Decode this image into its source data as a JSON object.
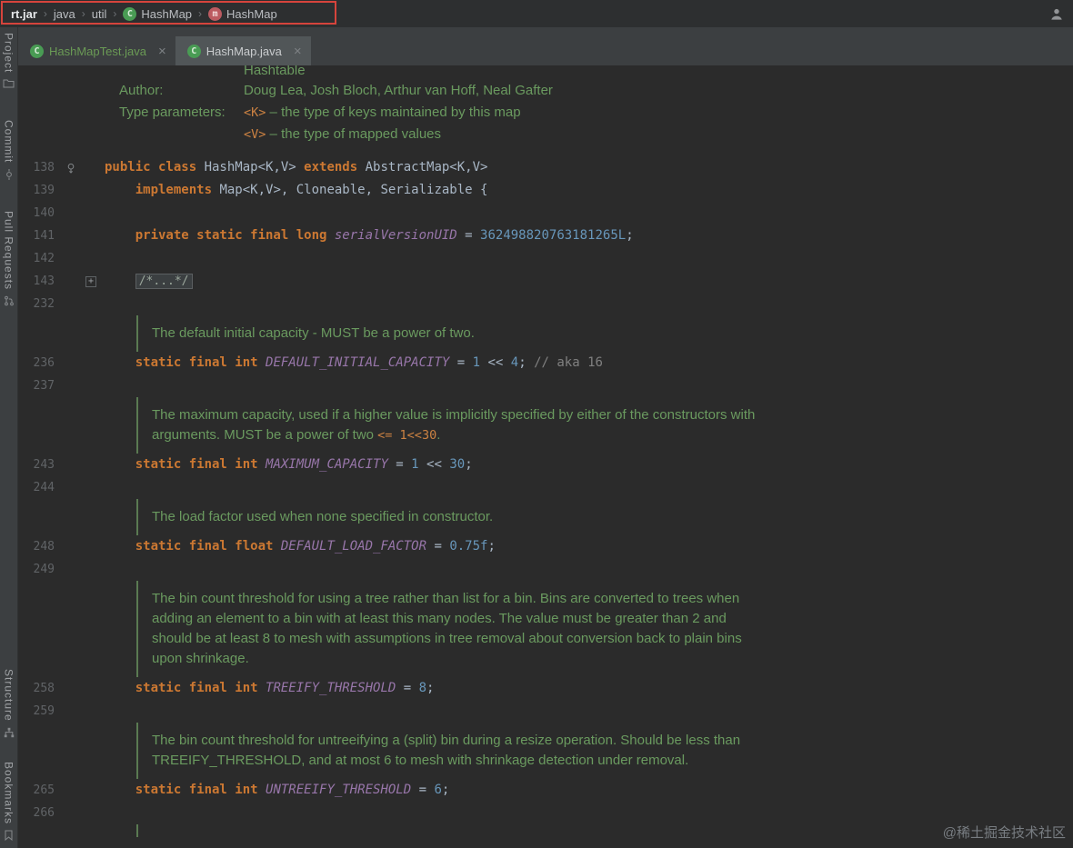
{
  "window": {
    "watermark": "@稀土掘金技术社区"
  },
  "colors": {
    "background": "#2B2B2B",
    "panel": "#3C3F41",
    "keyword": "#CC7832",
    "plain": "#A9B7C6",
    "constant": "#9876AA",
    "number": "#6897BB",
    "line_comment": "#808080",
    "doc_comment": "#6A9A5F",
    "doc_code": "#CC8242",
    "doc_bar": "#5A7A52",
    "line_number": "#606366",
    "vcs_added_green": "#6A9A55",
    "tab_active_bg": "#515658",
    "annotation_red": "#D6443C"
  },
  "breadcrumb_bar": {
    "separator": "›",
    "items": [
      {
        "label": "rt.jar",
        "bold": true
      },
      {
        "label": "java"
      },
      {
        "label": "util"
      },
      {
        "label": "HashMap",
        "icon": "class"
      },
      {
        "label": "HashMap",
        "icon": "method"
      }
    ]
  },
  "tab_bar": {
    "close_glyph": "×",
    "tabs": [
      {
        "label": "HashMapTest.java",
        "icon": "class",
        "active": false,
        "added": true
      },
      {
        "label": "HashMap.java",
        "icon": "class",
        "active": true,
        "added": false
      }
    ]
  },
  "tool_stripe": {
    "top": [
      {
        "label": "Project",
        "icon": "folder"
      },
      {
        "label": "Commit",
        "icon": "commit"
      },
      {
        "label": "Pull Requests",
        "icon": "pull-request"
      }
    ],
    "bottom": [
      {
        "label": "Structure",
        "icon": "structure"
      },
      {
        "label": "Bookmarks",
        "icon": "bookmark"
      }
    ]
  },
  "editor": {
    "blocks": [
      {
        "type": "doc-head",
        "partial": {
          "segs": [
            {
              "t": "Hashtable",
              "c": "doc"
            }
          ]
        },
        "rows": [
          {
            "label": "Author:",
            "segs": [
              {
                "t": "Doug Lea, Josh Bloch, Arthur van Hoff, Neal Gafter",
                "c": "doc"
              }
            ]
          },
          {
            "label": "Type parameters:",
            "segs": [
              {
                "t": "<K>",
                "c": "doccode"
              },
              {
                "t": " – the type of keys maintained by this map",
                "c": "doc"
              }
            ]
          },
          {
            "label": "",
            "segs": [
              {
                "t": "<V>",
                "c": "doccode"
              },
              {
                "t": " – the type of mapped values",
                "c": "doc"
              }
            ]
          }
        ]
      },
      {
        "type": "code",
        "ln": "138",
        "gutter_icon": "override",
        "segs": [
          {
            "t": "public class ",
            "c": "kw"
          },
          {
            "t": "HashMap<K,V> ",
            "c": "pl"
          },
          {
            "t": "extends ",
            "c": "kw"
          },
          {
            "t": "AbstractMap<K,V>",
            "c": "pl"
          }
        ]
      },
      {
        "type": "code",
        "ln": "139",
        "segs": [
          {
            "t": "    ",
            "c": "pl"
          },
          {
            "t": "implements ",
            "c": "kw"
          },
          {
            "t": "Map<K,V>, Cloneable, Serializable {",
            "c": "pl"
          }
        ]
      },
      {
        "type": "code",
        "ln": "140",
        "segs": []
      },
      {
        "type": "code",
        "ln": "141",
        "segs": [
          {
            "t": "    ",
            "c": "pl"
          },
          {
            "t": "private static final long ",
            "c": "kw"
          },
          {
            "t": "serialVersionUID",
            "c": "cf"
          },
          {
            "t": " = ",
            "c": "pl"
          },
          {
            "t": "362498820763181265L",
            "c": "num"
          },
          {
            "t": ";",
            "c": "pl"
          }
        ]
      },
      {
        "type": "code",
        "ln": "142",
        "segs": []
      },
      {
        "type": "code",
        "ln": "143",
        "gutter_icon": "fold",
        "segs": [
          {
            "t": "    ",
            "c": "pl"
          },
          {
            "t": "/*...*/",
            "c": "fold"
          }
        ]
      },
      {
        "type": "code",
        "ln": "232",
        "segs": []
      },
      {
        "type": "comment",
        "lines": [
          [
            {
              "t": "The default initial capacity - MUST be a power of two.",
              "c": "doc"
            }
          ]
        ]
      },
      {
        "type": "code",
        "ln": "236",
        "segs": [
          {
            "t": "    ",
            "c": "pl"
          },
          {
            "t": "static final int ",
            "c": "kw"
          },
          {
            "t": "DEFAULT_INITIAL_CAPACITY",
            "c": "cf"
          },
          {
            "t": " = ",
            "c": "pl"
          },
          {
            "t": "1",
            "c": "num"
          },
          {
            "t": " << ",
            "c": "pl"
          },
          {
            "t": "4",
            "c": "num"
          },
          {
            "t": "; ",
            "c": "pl"
          },
          {
            "t": "// aka 16",
            "c": "cm"
          }
        ]
      },
      {
        "type": "code",
        "ln": "237",
        "segs": []
      },
      {
        "type": "comment",
        "lines": [
          [
            {
              "t": "The maximum capacity, used if a higher value is implicitly specified by either of the constructors with",
              "c": "doc"
            }
          ],
          [
            {
              "t": "arguments. MUST be a power of two ",
              "c": "doc"
            },
            {
              "t": "<= 1<<30",
              "c": "doccode"
            },
            {
              "t": ".",
              "c": "doc"
            }
          ]
        ]
      },
      {
        "type": "code",
        "ln": "243",
        "segs": [
          {
            "t": "    ",
            "c": "pl"
          },
          {
            "t": "static final int ",
            "c": "kw"
          },
          {
            "t": "MAXIMUM_CAPACITY",
            "c": "cf"
          },
          {
            "t": " = ",
            "c": "pl"
          },
          {
            "t": "1",
            "c": "num"
          },
          {
            "t": " << ",
            "c": "pl"
          },
          {
            "t": "30",
            "c": "num"
          },
          {
            "t": ";",
            "c": "pl"
          }
        ]
      },
      {
        "type": "code",
        "ln": "244",
        "segs": []
      },
      {
        "type": "comment",
        "lines": [
          [
            {
              "t": "The load factor used when none specified in constructor.",
              "c": "doc"
            }
          ]
        ]
      },
      {
        "type": "code",
        "ln": "248",
        "segs": [
          {
            "t": "    ",
            "c": "pl"
          },
          {
            "t": "static final float ",
            "c": "kw"
          },
          {
            "t": "DEFAULT_LOAD_FACTOR",
            "c": "cf"
          },
          {
            "t": " = ",
            "c": "pl"
          },
          {
            "t": "0.75f",
            "c": "num"
          },
          {
            "t": ";",
            "c": "pl"
          }
        ]
      },
      {
        "type": "code",
        "ln": "249",
        "segs": []
      },
      {
        "type": "comment",
        "lines": [
          [
            {
              "t": "The bin count threshold for using a tree rather than list for a bin. Bins are converted to trees when",
              "c": "doc"
            }
          ],
          [
            {
              "t": "adding an element to a bin with at least this many nodes. The value must be greater than 2 and",
              "c": "doc"
            }
          ],
          [
            {
              "t": "should be at least 8 to mesh with assumptions in tree removal about conversion back to plain bins",
              "c": "doc"
            }
          ],
          [
            {
              "t": "upon shrinkage.",
              "c": "doc"
            }
          ]
        ]
      },
      {
        "type": "code",
        "ln": "258",
        "segs": [
          {
            "t": "    ",
            "c": "pl"
          },
          {
            "t": "static final int ",
            "c": "kw"
          },
          {
            "t": "TREEIFY_THRESHOLD",
            "c": "cf"
          },
          {
            "t": " = ",
            "c": "pl"
          },
          {
            "t": "8",
            "c": "num"
          },
          {
            "t": ";",
            "c": "pl"
          }
        ]
      },
      {
        "type": "code",
        "ln": "259",
        "segs": []
      },
      {
        "type": "comment",
        "lines": [
          [
            {
              "t": "The bin count threshold for untreeifying a (split) bin during a resize operation. Should be less than",
              "c": "doc"
            }
          ],
          [
            {
              "t": "TREEIFY_THRESHOLD, and at most 6 to mesh with shrinkage detection under removal.",
              "c": "doc"
            }
          ]
        ]
      },
      {
        "type": "code",
        "ln": "265",
        "segs": [
          {
            "t": "    ",
            "c": "pl"
          },
          {
            "t": "static final int ",
            "c": "kw"
          },
          {
            "t": "UNTREEIFY_THRESHOLD",
            "c": "cf"
          },
          {
            "t": " = ",
            "c": "pl"
          },
          {
            "t": "6",
            "c": "num"
          },
          {
            "t": ";",
            "c": "pl"
          }
        ]
      },
      {
        "type": "code",
        "ln": "266",
        "segs": []
      },
      {
        "type": "bar-stub"
      }
    ]
  }
}
